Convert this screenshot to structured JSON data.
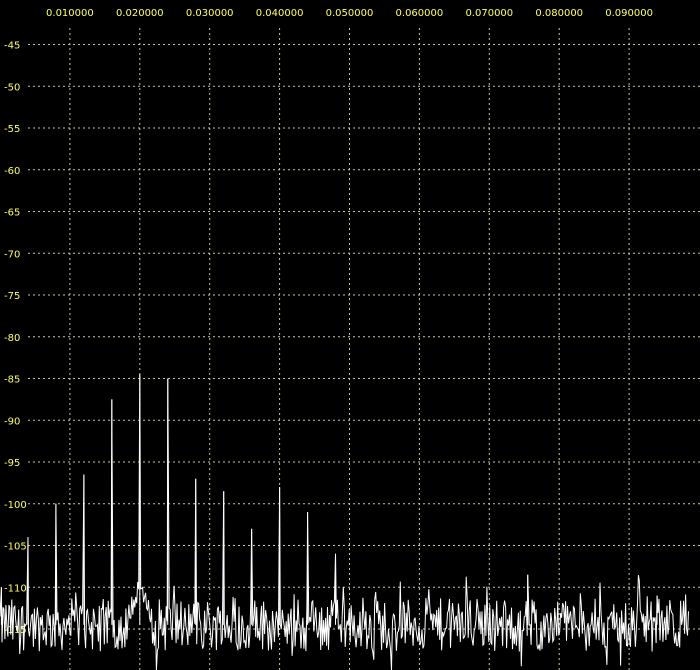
{
  "chart_data": {
    "type": "line",
    "title": "",
    "xlabel": "",
    "ylabel": "",
    "xlim": [
      0.0,
      0.0985
    ],
    "ylim": [
      -120,
      -42
    ],
    "x_ticks": [
      "0.010000",
      "0.020000",
      "0.030000",
      "0.040000",
      "0.050000",
      "0.060000",
      "0.070000",
      "0.080000",
      "0.090000"
    ],
    "y_ticks": [
      "-45",
      "-50",
      "-55",
      "-60",
      "-65",
      "-70",
      "-75",
      "-80",
      "-85",
      "-90",
      "-95",
      "-100",
      "-105",
      "-110",
      "-115"
    ],
    "grid": true,
    "colors": {
      "background": "#000000",
      "grid": "#c8c8a0",
      "tick_text": "#ffff66",
      "trace": "#ffffff"
    },
    "series": [
      {
        "noise_floor": -114.5,
        "noise_spread": 3.2,
        "spikes": [
          {
            "x": 0.0002,
            "y": -110
          },
          {
            "x": 0.004,
            "y": -104
          },
          {
            "x": 0.008,
            "y": -100
          },
          {
            "x": 0.012,
            "y": -96.5
          },
          {
            "x": 0.016,
            "y": -87.5
          },
          {
            "x": 0.02,
            "y": -84.5
          },
          {
            "x": 0.024,
            "y": -85
          },
          {
            "x": 0.028,
            "y": -97
          },
          {
            "x": 0.032,
            "y": -98.5
          },
          {
            "x": 0.036,
            "y": -103
          },
          {
            "x": 0.04,
            "y": -98
          },
          {
            "x": 0.044,
            "y": -101
          },
          {
            "x": 0.048,
            "y": -106
          },
          {
            "x": 0.0755,
            "y": -108.5
          },
          {
            "x": 0.094,
            "y": -111
          }
        ]
      }
    ]
  }
}
